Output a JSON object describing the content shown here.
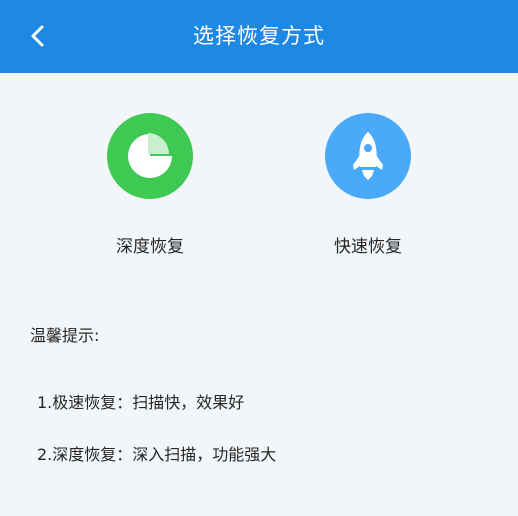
{
  "header": {
    "title": "选择恢复方式",
    "back_icon": "chevron-left-icon",
    "background_color": "#1e88e5"
  },
  "options": [
    {
      "label": "深度恢复",
      "icon": "pie-chart-icon",
      "color": "#3dc952"
    },
    {
      "label": "快速恢复",
      "icon": "rocket-icon",
      "color": "#4aa9f8"
    }
  ],
  "tips": {
    "title": "温馨提示:",
    "items": [
      "1.极速恢复：扫描快，效果好",
      "2.深度恢复：深入扫描，功能强大"
    ]
  }
}
